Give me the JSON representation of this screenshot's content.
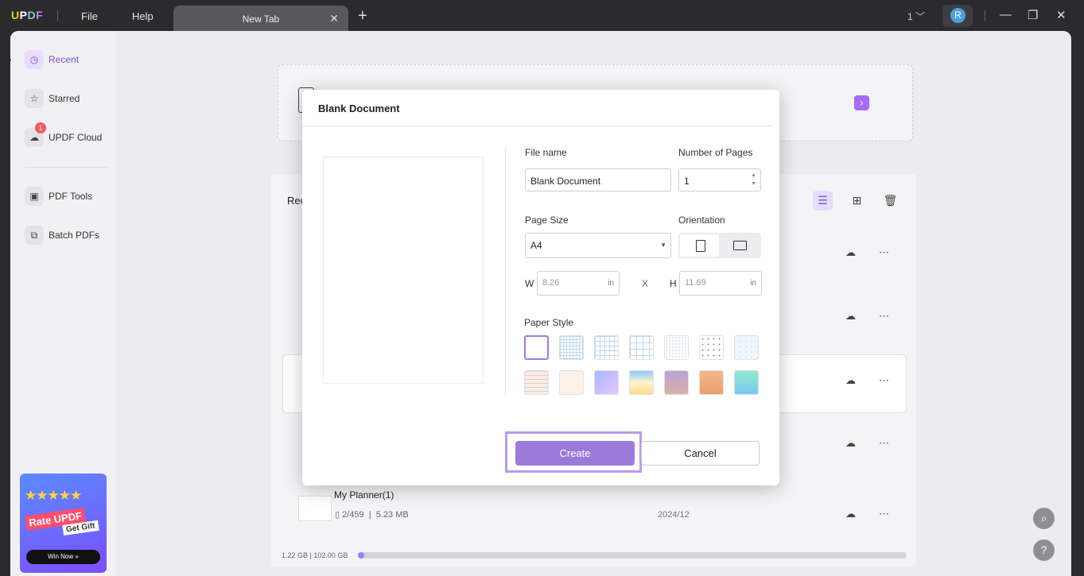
{
  "titlebar": {
    "logo": "UPDF",
    "menus": [
      "File",
      "Help"
    ],
    "tab_label": "New Tab",
    "page_indicator": "1",
    "avatar_letter": "R"
  },
  "sidebar": {
    "items": [
      {
        "label": "Recent",
        "icon": "clock-icon",
        "active": true
      },
      {
        "label": "Starred",
        "icon": "star-icon"
      },
      {
        "label": "UPDF Cloud",
        "icon": "cloud-icon",
        "badge": "1"
      },
      {
        "label": "PDF Tools",
        "icon": "toolbox-icon"
      },
      {
        "label": "Batch PDFs",
        "icon": "batch-icon"
      }
    ],
    "promo": {
      "top": "Rate UPDF",
      "gift": "Get Gift",
      "button": "Win Now »"
    }
  },
  "main": {
    "section_title": "Rec",
    "files": [
      {
        "name": "",
        "meta": "",
        "date": ""
      },
      {
        "name": "",
        "meta": "",
        "date": ""
      },
      {
        "name": "",
        "meta": "",
        "date": ""
      },
      {
        "name": "",
        "meta": "",
        "date": ""
      },
      {
        "name": "My Planner(1)",
        "pages": "2/459",
        "size": "5.23 MB",
        "date": "2024/12"
      }
    ],
    "storage_text": "1.22 GB | 102.00 GB",
    "storage_used_fraction": 0.012
  },
  "dialog": {
    "title": "Blank Document",
    "file_name_label": "File name",
    "file_name_value": "Blank Document",
    "pages_label": "Number of Pages",
    "pages_value": "1",
    "page_size_label": "Page Size",
    "page_size_value": "A4",
    "orientation_label": "Orientation",
    "w_label": "W",
    "w_value": "8.26",
    "h_label": "H",
    "h_value": "11.69",
    "unit": "in",
    "x_label": "X",
    "paper_style_label": "Paper Style",
    "create_label": "Create",
    "cancel_label": "Cancel"
  },
  "colors": {
    "accent": "#9b7bd9",
    "brand_purple": "#7a4fd6"
  }
}
